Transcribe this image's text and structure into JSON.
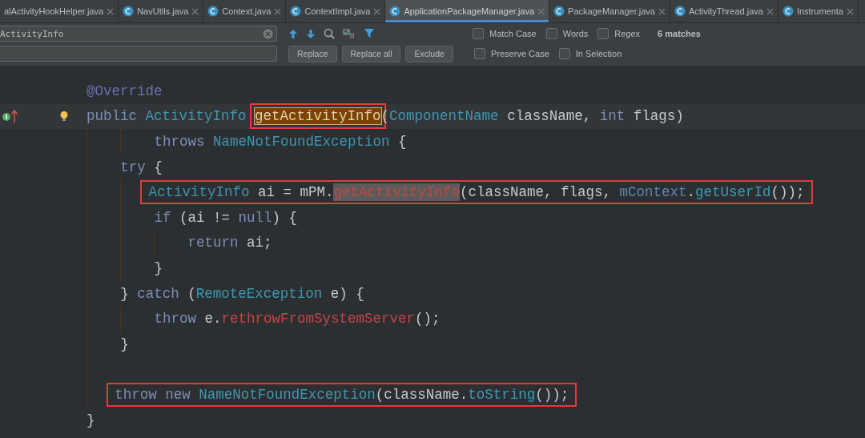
{
  "tabs": [
    {
      "label": "alActivityHookHelper.java",
      "icon": false,
      "selected": false
    },
    {
      "label": "NavUtils.java",
      "icon": true,
      "selected": false
    },
    {
      "label": "Context.java",
      "icon": true,
      "selected": false
    },
    {
      "label": "ContextImpl.java",
      "icon": true,
      "selected": false
    },
    {
      "label": "ApplicationPackageManager.java",
      "icon": true,
      "selected": true
    },
    {
      "label": "PackageManager.java",
      "icon": true,
      "selected": false
    },
    {
      "label": "ActivityThread.java",
      "icon": true,
      "selected": false
    },
    {
      "label": "Instrumenta",
      "icon": true,
      "selected": false
    }
  ],
  "find": {
    "value": "ActivityInfo",
    "options": [
      {
        "label": "Match Case",
        "checked": false
      },
      {
        "label": "Words",
        "checked": false
      },
      {
        "label": "Regex",
        "checked": false
      }
    ],
    "matches": "6 matches"
  },
  "replace": {
    "buttons": [
      "Replace",
      "Replace all",
      "Exclude"
    ],
    "options": [
      {
        "label": "Preserve Case",
        "checked": false
      },
      {
        "label": "In Selection",
        "checked": false
      }
    ]
  },
  "lines": [
    {
      "kind": "code",
      "tokens": [
        {
          "text": "@Override",
          "kind": "annotation"
        }
      ]
    },
    {
      "kind": "code",
      "current": true,
      "tokens": [
        {
          "text": "public ",
          "kind": "keyword"
        },
        {
          "text": "ActivityInfo ",
          "kind": "type"
        },
        {
          "text": "getActivityInfo",
          "kind": "match-current"
        },
        {
          "text": "(",
          "kind": "plain"
        },
        {
          "text": "ComponentName ",
          "kind": "type"
        },
        {
          "text": "className, ",
          "kind": "plain"
        },
        {
          "text": "int ",
          "kind": "keyword"
        },
        {
          "text": "flags)",
          "kind": "plain"
        }
      ],
      "children": [
        {
          "kind": "continuation",
          "tokens": [
            {
              "text": "throws ",
              "kind": "keyword"
            },
            {
              "text": "NameNotFoundException ",
              "kind": "type"
            },
            {
              "text": "{",
              "kind": "plain"
            }
          ]
        },
        {
          "kind": "code",
          "tokens": [
            {
              "text": "try ",
              "kind": "keyword"
            },
            {
              "text": "{",
              "kind": "plain"
            }
          ],
          "children": [
            {
              "kind": "code",
              "boxed": true,
              "tokens": [
                {
                  "text": "ActivityInfo ",
                  "kind": "type"
                },
                {
                  "text": "ai = mPM.",
                  "kind": "plain"
                },
                {
                  "text": "getActivityInfo",
                  "kind": "match"
                },
                {
                  "text": "(className, flags, ",
                  "kind": "plain"
                },
                {
                  "text": "mContext",
                  "kind": "field"
                },
                {
                  "text": ".",
                  "kind": "plain"
                },
                {
                  "text": "getUserId",
                  "kind": "method"
                },
                {
                  "text": "());",
                  "kind": "plain"
                }
              ]
            },
            {
              "kind": "code",
              "tokens": [
                {
                  "text": "if ",
                  "kind": "keyword"
                },
                {
                  "text": "(ai != ",
                  "kind": "plain"
                },
                {
                  "text": "null",
                  "kind": "keyword"
                },
                {
                  "text": ") {",
                  "kind": "plain"
                }
              ],
              "children": [
                {
                  "kind": "code",
                  "tokens": [
                    {
                      "text": "return ",
                      "kind": "keyword"
                    },
                    {
                      "text": "ai;",
                      "kind": "plain"
                    }
                  ]
                }
              ]
            },
            {
              "kind": "code",
              "tokens": [
                {
                  "text": "}",
                  "kind": "plain"
                }
              ]
            }
          ]
        },
        {
          "kind": "code",
          "tokens": [
            {
              "text": "} ",
              "kind": "plain"
            },
            {
              "text": "catch ",
              "kind": "keyword"
            },
            {
              "text": "(",
              "kind": "plain"
            },
            {
              "text": "RemoteException ",
              "kind": "type"
            },
            {
              "text": "e) {",
              "kind": "plain"
            }
          ],
          "children": [
            {
              "kind": "code",
              "tokens": [
                {
                  "text": "throw ",
                  "kind": "keyword"
                },
                {
                  "text": "e.",
                  "kind": "plain"
                },
                {
                  "text": "rethrowFromSystemServer",
                  "kind": "call"
                },
                {
                  "text": "();",
                  "kind": "plain"
                }
              ]
            }
          ]
        },
        {
          "kind": "code",
          "tokens": [
            {
              "text": "}",
              "kind": "plain"
            }
          ]
        },
        {
          "kind": "blank"
        },
        {
          "kind": "code",
          "boxed": true,
          "tokens": [
            {
              "text": "throw new ",
              "kind": "keyword"
            },
            {
              "text": "NameNotFoundException",
              "kind": "type"
            },
            {
              "text": "(className.",
              "kind": "plain"
            },
            {
              "text": "toString",
              "kind": "method"
            },
            {
              "text": "());",
              "kind": "plain"
            }
          ]
        }
      ]
    },
    {
      "kind": "code",
      "tokens": [
        {
          "text": "}",
          "kind": "plain"
        }
      ]
    }
  ]
}
